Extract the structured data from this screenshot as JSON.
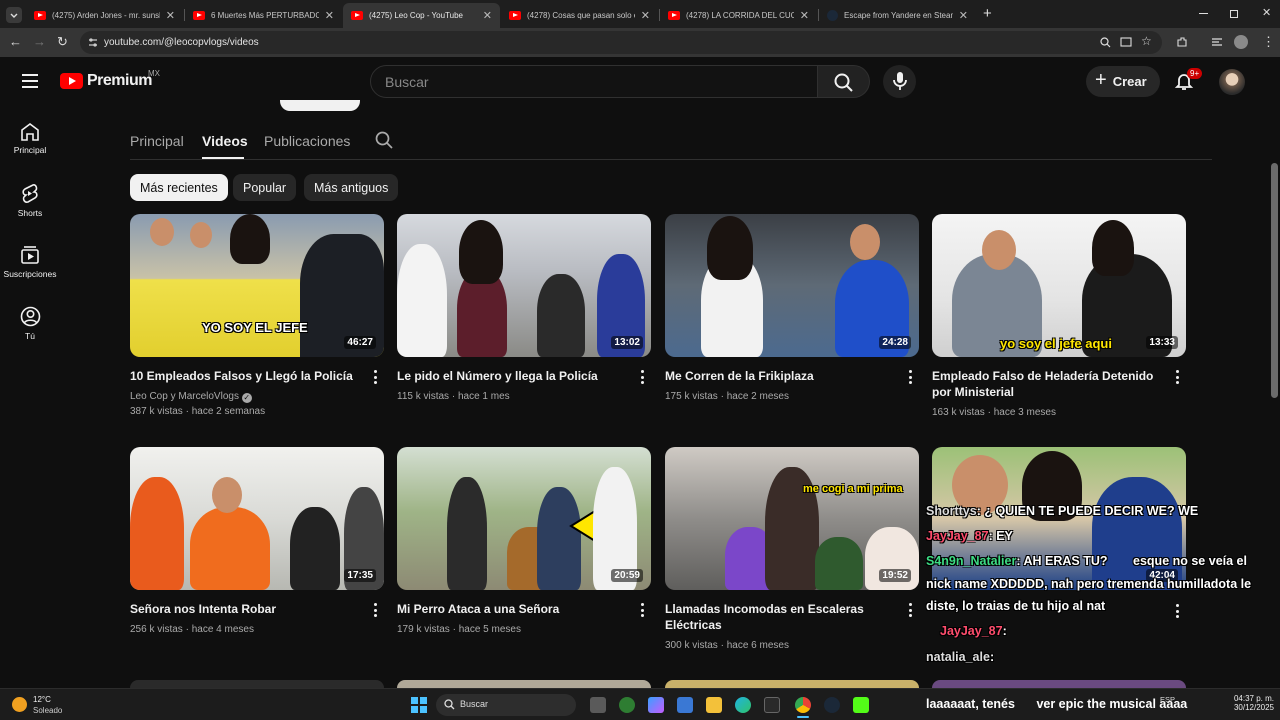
{
  "browser": {
    "tabs": [
      {
        "title": "(4275) Arden Jones - mr. sunsh",
        "active": false
      },
      {
        "title": "6 Muertes Más PERTURBADORAS",
        "active": false
      },
      {
        "title": "(4275) Leo Cop - YouTube",
        "active": true
      },
      {
        "title": "(4278) Cosas que pasan solo en",
        "active": false
      },
      {
        "title": "(4278) LA CORRIDA DEL CUCHA",
        "active": false
      },
      {
        "title": "Escape from Yandere en Steam",
        "active": false
      }
    ],
    "url": "youtube.com/@leocopvlogs/videos"
  },
  "header": {
    "logo_text": "Premium",
    "country": "MX",
    "search_placeholder": "Buscar",
    "create_label": "Crear",
    "notification_count": "9+"
  },
  "sidebar": {
    "items": [
      {
        "label": "Principal",
        "icon": "home-icon"
      },
      {
        "label": "Shorts",
        "icon": "shorts-icon"
      },
      {
        "label": "Suscripciones",
        "icon": "subscriptions-icon"
      },
      {
        "label": "Tú",
        "icon": "you-icon"
      }
    ]
  },
  "channel_tabs": [
    {
      "label": "Principal",
      "active": false
    },
    {
      "label": "Videos",
      "active": true
    },
    {
      "label": "Publicaciones",
      "active": false
    }
  ],
  "filters": [
    {
      "label": "Más recientes",
      "active": true
    },
    {
      "label": "Popular",
      "active": false
    },
    {
      "label": "Más antiguos",
      "active": false
    }
  ],
  "videos": [
    {
      "title": "10 Empleados Falsos y Llegó la Policía",
      "channel": "Leo Cop y MarceloVlogs",
      "verified": true,
      "views": "387 k vistas",
      "age": "hace 2 semanas",
      "duration": "46:27",
      "thumb_caption": "YO SOY EL JEFE"
    },
    {
      "title": "Le pido el Número y llega la Policía",
      "channel": "",
      "views": "115 k vistas",
      "age": "hace 1 mes",
      "duration": "13:02",
      "thumb_caption": ""
    },
    {
      "title": "Me Corren de la Frikiplaza",
      "channel": "",
      "views": "175 k vistas",
      "age": "hace 2 meses",
      "duration": "24:28",
      "thumb_caption": ""
    },
    {
      "title": "Empleado Falso de Heladería Detenido por Ministerial",
      "channel": "",
      "views": "163 k vistas",
      "age": "hace 3 meses",
      "duration": "13:33",
      "thumb_caption": "yo soy el jefe aqui"
    },
    {
      "title": "Señora nos Intenta Robar",
      "channel": "",
      "views": "256 k vistas",
      "age": "hace 4 meses",
      "duration": "17:35",
      "thumb_caption": ""
    },
    {
      "title": "Mi Perro Ataca a una Señora",
      "channel": "",
      "views": "179 k vistas",
      "age": "hace 5 meses",
      "duration": "20:59",
      "thumb_caption": ""
    },
    {
      "title": "Llamadas Incomodas en Escaleras Eléctricas",
      "channel": "",
      "views": "300 k vistas",
      "age": "hace 6 meses",
      "duration": "19:52",
      "thumb_caption": "me cogi a mi prima"
    },
    {
      "title": "",
      "channel": "",
      "views": "",
      "age": "",
      "duration": "42:04",
      "thumb_caption": ""
    }
  ],
  "chat_overlay": [
    {
      "user": "Shorttys",
      "message": ": ¿ QUIEN TE PUEDE DECIR WE? WE"
    },
    {
      "user": "JayJay_87",
      "message": ": EY"
    },
    {
      "user": "S4n9n_Natalier",
      "message": ": AH ERAS TU?"
    },
    {
      "user": "",
      "message": "esque no se veía el"
    },
    {
      "user": "",
      "message": "nick name XDDDDD, nah pero tremenda humilladota le"
    },
    {
      "user": "",
      "message": "diste, lo traias de tu hijo al nat"
    },
    {
      "user": "JayJay_87",
      "message": ":"
    },
    {
      "user": "natalia_ale",
      "message": ":"
    },
    {
      "user": "",
      "message": "laaaaaat, tenés"
    },
    {
      "user": "",
      "message": "ver epic the musical aaaa"
    }
  ],
  "taskbar": {
    "temperature": "12°C",
    "condition": "Soleado",
    "search_label": "Buscar",
    "language": "ESP",
    "time": "04:37 p. m.",
    "date": "30/12/2025"
  },
  "colors": {
    "background": "#0f0f0f",
    "brand_red": "#ff0000",
    "chip_active": "#f1f1f1",
    "chat_green": "#3ddc84"
  }
}
